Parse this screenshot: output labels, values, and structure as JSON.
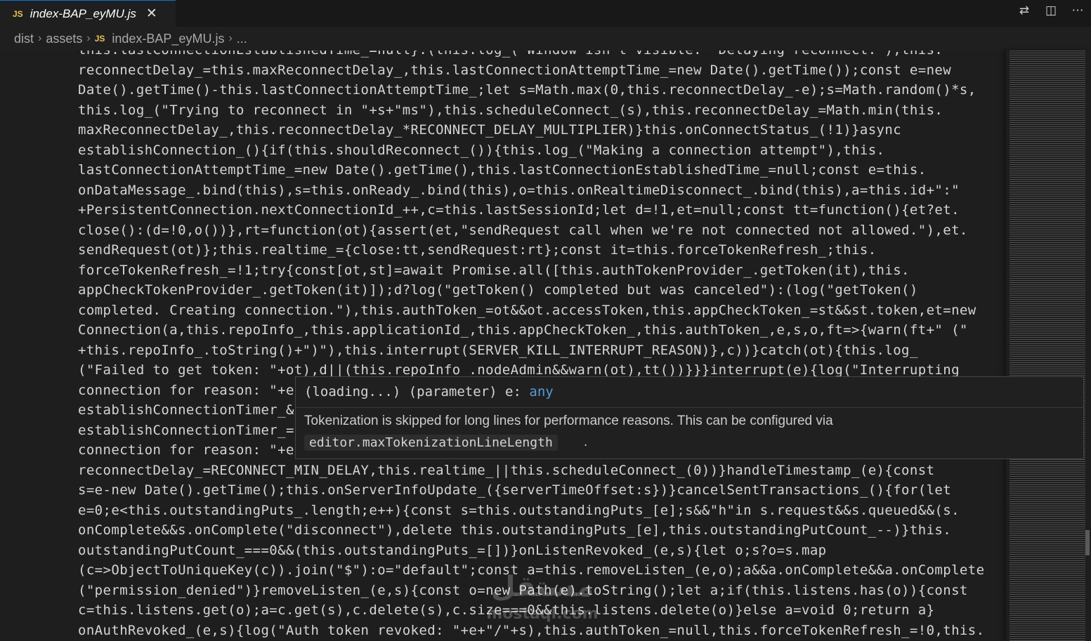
{
  "tab": {
    "badge": "JS",
    "filename": "index-BAP_eyMU.js",
    "close": "✕"
  },
  "actions": {
    "compare": "⇄",
    "split": "◫",
    "more": "⋯"
  },
  "breadcrumb": {
    "items": [
      "dist",
      "assets",
      "index-BAP_eyMU.js",
      "..."
    ],
    "separator": "›",
    "file_badge": "JS"
  },
  "code_lines": [
    "this.lastConnectionEstablishedTime_=null}:(this.log_(\"Window isn't visible.  Delaying reconnect.\"),this.",
    "reconnectDelay_=this.maxReconnectDelay_,this.lastConnectionAttemptTime_=new Date().getTime());const e=new",
    "Date().getTime()-this.lastConnectionAttemptTime_;let s=Math.max(0,this.reconnectDelay_-e);s=Math.random()*s,",
    "this.log_(\"Trying to reconnect in \"+s+\"ms\"),this.scheduleConnect_(s),this.reconnectDelay_=Math.min(this.",
    "maxReconnectDelay_,this.reconnectDelay_*RECONNECT_DELAY_MULTIPLIER)}this.onConnectStatus_(!1)}async",
    "establishConnection_(){if(this.shouldReconnect_()){this.log_(\"Making a connection attempt\"),this.",
    "lastConnectionAttemptTime_=new Date().getTime(),this.lastConnectionEstablishedTime_=null;const e=this.",
    "onDataMessage_.bind(this),s=this.onReady_.bind(this),o=this.onRealtimeDisconnect_.bind(this),a=this.id+\":\"",
    "+PersistentConnection.nextConnectionId_++,c=this.lastSessionId;let d=!1,et=null;const tt=function(){et?et.",
    "close():(d=!0,o())},rt=function(ot){assert(et,\"sendRequest call when we're not connected not allowed.\"),et.",
    "sendRequest(ot)};this.realtime_={close:tt,sendRequest:rt};const it=this.forceTokenRefresh_;this.",
    "forceTokenRefresh_=!1;try{const[ot,st]=await Promise.all([this.authTokenProvider_.getToken(it),this.",
    "appCheckTokenProvider_.getToken(it)]);d?log(\"getToken() completed but was canceled\"):(log(\"getToken()",
    "completed. Creating connection.\"),this.authToken_=ot&&ot.accessToken,this.appCheckToken_=st&&st.token,et=new",
    "Connection(a,this.repoInfo_,this.applicationId_,this.appCheckToken_,this.authToken_,e,s,o,ft=>{warn(ft+\" (\"",
    "+this.repoInfo_.toString()+\")\"),this.interrupt(SERVER_KILL_INTERRUPT_REASON)},c))}catch(ot){this.log_",
    "(\"Failed to get token: \"+ot),d||(this.repoInfo_.nodeAdmin&&warn(ot),tt())}}}interrupt(e){log(\"Interrupting",
    "connection for reason: \"+e",
    "establishConnectionTimer_&",
    "establishConnectionTimer_=",
    "connection for reason: \"+e",
    "reconnectDelay_=RECONNECT_MIN_DELAY,this.realtime_||this.scheduleConnect_(0))}handleTimestamp_(e){const",
    "s=e-new Date().getTime();this.onServerInfoUpdate_({serverTimeOffset:s})}cancelSentTransactions_(){for(let",
    "e=0;e<this.outstandingPuts_.length;e++){const s=this.outstandingPuts_[e];s&&\"h\"in s.request&&s.queued&&(s.",
    "onComplete&&s.onComplete(\"disconnect\"),delete this.outstandingPuts_[e],this.outstandingPutCount_--)}this.",
    "outstandingPutCount_===0&&(this.outstandingPuts_=[])}onListenRevoked_(e,s){let o;s?o=s.map",
    "(c=>ObjectToUniqueKey(c)).join(\"$\"):o=\"default\";const a=this.removeListen_(e,o);a&&a.onComplete&&a.onComplete",
    "(\"permission_denied\")}removeListen_(e,s){const o=new Path(e).toString();let a;if(this.listens.has(o)){const",
    "c=this.listens.get(o);a=c.get(s),c.delete(s),c.size===0&&this.listens.delete(o)}else a=void 0;return a}",
    "onAuthRevoked_(e,s){log(\"Auth token revoked: \"+e+\"/\"+s),this.authToken_=null,this.forceTokenRefresh_=!0,this."
  ],
  "hover": {
    "loading": "(loading...)",
    "kind": "(parameter)",
    "name": "e:",
    "type": "any",
    "message": "Tokenization is skipped for long lines for performance reasons. This can be configured via",
    "setting": "editor.maxTokenizationLineLength",
    "period": "."
  },
  "watermark": {
    "arabic": "مستقل",
    "latin": "mostaql.com"
  },
  "colors": {
    "editor_bg": "#1e1e1e",
    "tab_accent": "#0078d4",
    "js_badge": "#e8c547",
    "keyword": "#569cd6"
  }
}
